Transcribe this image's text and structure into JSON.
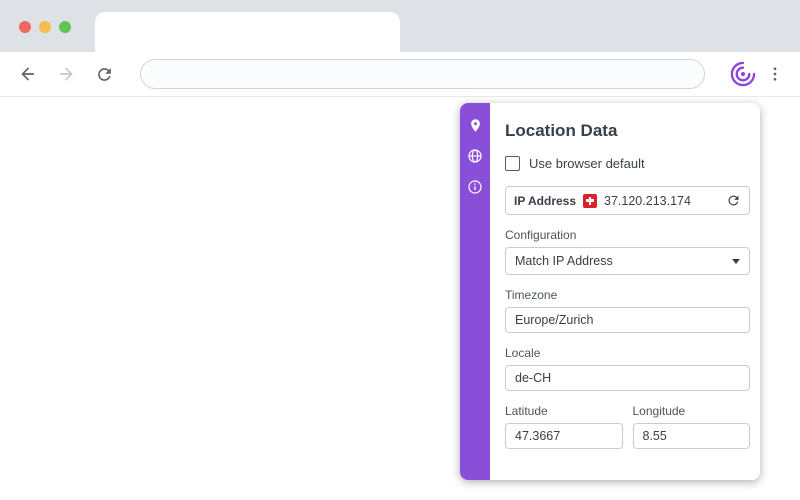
{
  "browser": {
    "address_bar": {
      "value": "",
      "placeholder": ""
    }
  },
  "panel": {
    "title": "Location Data",
    "default_checkbox": {
      "label": "Use browser default",
      "checked": false
    },
    "ip": {
      "label": "IP Address",
      "value": "37.120.213.174",
      "country": "CH"
    },
    "fields": {
      "configuration": {
        "label": "Configuration",
        "value": "Match IP Address"
      },
      "timezone": {
        "label": "Timezone",
        "value": "Europe/Zurich"
      },
      "locale": {
        "label": "Locale",
        "value": "de-CH"
      },
      "latitude": {
        "label": "Latitude",
        "value": "47.3667"
      },
      "longitude": {
        "label": "Longitude",
        "value": "8.55"
      }
    }
  },
  "icons": {
    "toolbar": [
      "back-icon",
      "forward-icon",
      "reload-icon",
      "extension-logo-icon",
      "kebab-menu-icon"
    ],
    "sidebar": [
      "location-pin-icon",
      "globe-icon",
      "info-icon"
    ],
    "inline": [
      "swiss-flag-icon",
      "ip-refresh-icon",
      "chevron-down-icon",
      "checkbox"
    ]
  },
  "colors": {
    "accent": "#8a4fd8",
    "flag_red": "#d8232a",
    "chrome_strip": "#dee1e6"
  }
}
